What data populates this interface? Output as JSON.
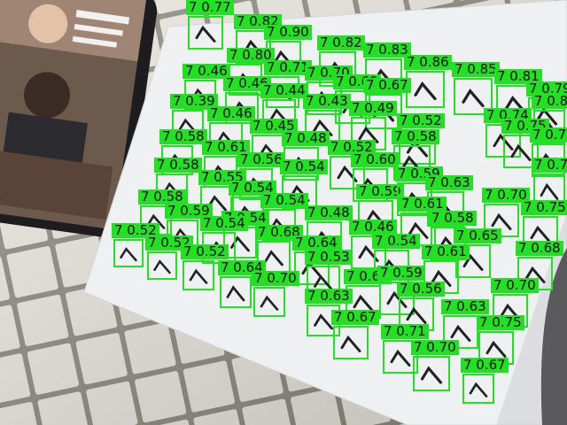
{
  "image": {
    "subject": "photo of tiled floor with a phone and a sheet of paper covered in handwritten check marks, with object-detection overlays",
    "colors": {
      "tile": "#e9e6de",
      "grout": "#8d8a7f",
      "paper": "#eef0f2",
      "phone_body": "#1d1d1f",
      "detection_green": "#22e022",
      "ink": "#222222"
    }
  },
  "detections": [
    {
      "label": "7",
      "score": "0.77"
    },
    {
      "label": "7",
      "score": "0.82"
    },
    {
      "label": "7",
      "score": "0.90"
    },
    {
      "label": "7",
      "score": "0.82"
    },
    {
      "label": "7",
      "score": "0.83"
    },
    {
      "label": "7",
      "score": "0.86"
    },
    {
      "label": "7",
      "score": "0.85"
    },
    {
      "label": "7",
      "score": "0.81"
    },
    {
      "label": "7",
      "score": "0.79"
    },
    {
      "label": "7",
      "score": "0.84"
    },
    {
      "label": "7",
      "score": "0.80"
    },
    {
      "label": "7",
      "score": "0.71"
    },
    {
      "label": "7",
      "score": "0.70"
    },
    {
      "label": "7",
      "score": "0.69"
    },
    {
      "label": "7",
      "score": "0.67"
    },
    {
      "label": "7",
      "score": "0.46"
    },
    {
      "label": "7",
      "score": "0.46"
    },
    {
      "label": "7",
      "score": "0.44"
    },
    {
      "label": "7",
      "score": "0.43"
    },
    {
      "label": "7",
      "score": "0.49"
    },
    {
      "label": "7",
      "score": "0.39"
    },
    {
      "label": "7",
      "score": "0.46"
    },
    {
      "label": "7",
      "score": "0.45"
    },
    {
      "label": "7",
      "score": "0.52"
    },
    {
      "label": "7",
      "score": "0.58"
    },
    {
      "label": "7",
      "score": "0.61"
    },
    {
      "label": "7",
      "score": "0.48"
    },
    {
      "label": "7",
      "score": "0.52"
    },
    {
      "label": "7",
      "score": "0.58"
    },
    {
      "label": "7",
      "score": "0.56"
    },
    {
      "label": "7",
      "score": "0.54"
    },
    {
      "label": "7",
      "score": "0.60"
    },
    {
      "label": "7",
      "score": "0.74"
    },
    {
      "label": "7",
      "score": "0.75"
    },
    {
      "label": "7",
      "score": "0.73"
    },
    {
      "label": "7",
      "score": "0.58"
    },
    {
      "label": "7",
      "score": "0.55"
    },
    {
      "label": "7",
      "score": "0.54"
    },
    {
      "label": "7",
      "score": "0.59"
    },
    {
      "label": "7",
      "score": "0.59"
    },
    {
      "label": "7",
      "score": "0.63"
    },
    {
      "label": "7",
      "score": "0.73"
    },
    {
      "label": "7",
      "score": "0.58"
    },
    {
      "label": "7",
      "score": "0.54"
    },
    {
      "label": "7",
      "score": "0.54"
    },
    {
      "label": "7",
      "score": "0.61"
    },
    {
      "label": "7",
      "score": "0.70"
    },
    {
      "label": "7",
      "score": "0.75"
    },
    {
      "label": "7",
      "score": "0.59"
    },
    {
      "label": "7",
      "score": "0.54"
    },
    {
      "label": "7",
      "score": "0.48"
    },
    {
      "label": "7",
      "score": "0.46"
    },
    {
      "label": "7",
      "score": "0.58"
    },
    {
      "label": "7",
      "score": "0.52"
    },
    {
      "label": "7",
      "score": "0.68"
    },
    {
      "label": "7",
      "score": "0.54"
    },
    {
      "label": "7",
      "score": "0.65"
    },
    {
      "label": "7",
      "score": "0.52"
    },
    {
      "label": "7",
      "score": "0.52"
    },
    {
      "label": "7",
      "score": "0.64"
    },
    {
      "label": "7",
      "score": "0.61"
    },
    {
      "label": "7",
      "score": "0.68"
    },
    {
      "label": "7",
      "score": "0.64"
    },
    {
      "label": "7",
      "score": "0.53"
    },
    {
      "label": "7",
      "score": "0.67"
    },
    {
      "label": "7",
      "score": "0.70"
    },
    {
      "label": "7",
      "score": "0.59"
    },
    {
      "label": "7",
      "score": "0.70"
    },
    {
      "label": "7",
      "score": "0.56"
    },
    {
      "label": "7",
      "score": "0.63"
    },
    {
      "label": "7",
      "score": "0.63"
    },
    {
      "label": "7",
      "score": "0.67"
    },
    {
      "label": "7",
      "score": "0.75"
    },
    {
      "label": "7",
      "score": "0.71"
    },
    {
      "label": "7",
      "score": "0.70"
    },
    {
      "label": "7",
      "score": "0.67"
    }
  ]
}
